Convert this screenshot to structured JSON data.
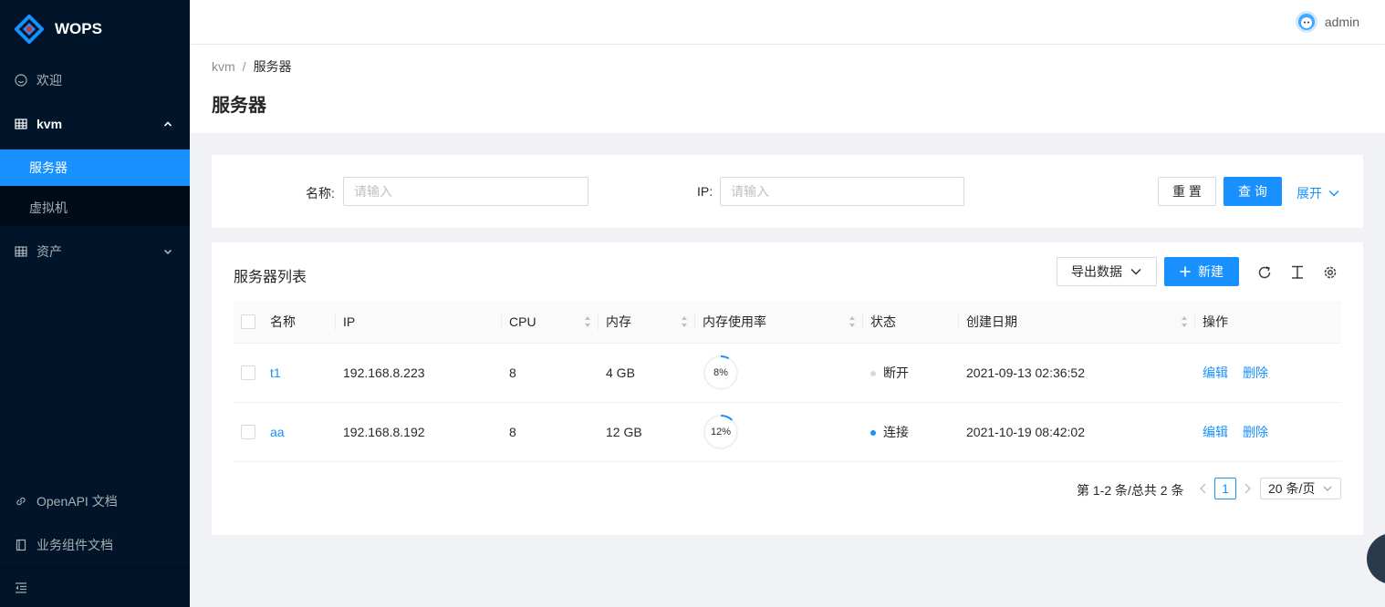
{
  "app": {
    "name": "WOPS"
  },
  "sidebar": {
    "items": [
      {
        "label": "欢迎",
        "icon": "smile-icon"
      },
      {
        "label": "kvm",
        "icon": "table-icon",
        "open": true,
        "children": [
          {
            "label": "服务器",
            "selected": true
          },
          {
            "label": "虚拟机"
          }
        ]
      },
      {
        "label": "资产",
        "icon": "table-icon"
      }
    ],
    "bottom": [
      {
        "label": "OpenAPI 文档",
        "icon": "link-icon"
      },
      {
        "label": "业务组件文档",
        "icon": "book-icon"
      }
    ]
  },
  "header": {
    "username": "admin"
  },
  "breadcrumb": {
    "parent": "kvm",
    "separator": "/",
    "current": "服务器"
  },
  "page": {
    "title": "服务器"
  },
  "search": {
    "name_label": "名称",
    "name_placeholder": "请输入",
    "ip_label": "IP",
    "ip_placeholder": "请输入",
    "reset_label": "重 置",
    "query_label": "查 询",
    "expand_label": "展开"
  },
  "table": {
    "title": "服务器列表",
    "export_label": "导出数据",
    "new_label": "新建",
    "columns": [
      "名称",
      "IP",
      "CPU",
      "内存",
      "内存使用率",
      "状态",
      "创建日期",
      "操作"
    ],
    "rows": [
      {
        "name": "t1",
        "ip": "192.168.8.223",
        "cpu": "8",
        "memory": "4 GB",
        "mem_usage": "8%",
        "mem_usage_value": 8,
        "status": "断开",
        "status_color": "#d9d9d9",
        "created": "2021-09-13 02:36:52"
      },
      {
        "name": "aa",
        "ip": "192.168.8.192",
        "cpu": "8",
        "memory": "12 GB",
        "mem_usage": "12%",
        "mem_usage_value": 12,
        "status": "连接",
        "status_color": "#1890ff",
        "created": "2021-10-19 08:42:02"
      }
    ],
    "actions": {
      "edit": "编辑",
      "delete": "删除"
    }
  },
  "pagination": {
    "total_text": "第 1-2 条/总共 2 条",
    "current": "1",
    "page_size": "20 条/页"
  },
  "colors": {
    "primary": "#1890ff",
    "sider": "#001529",
    "sider_sub": "#000c17"
  }
}
